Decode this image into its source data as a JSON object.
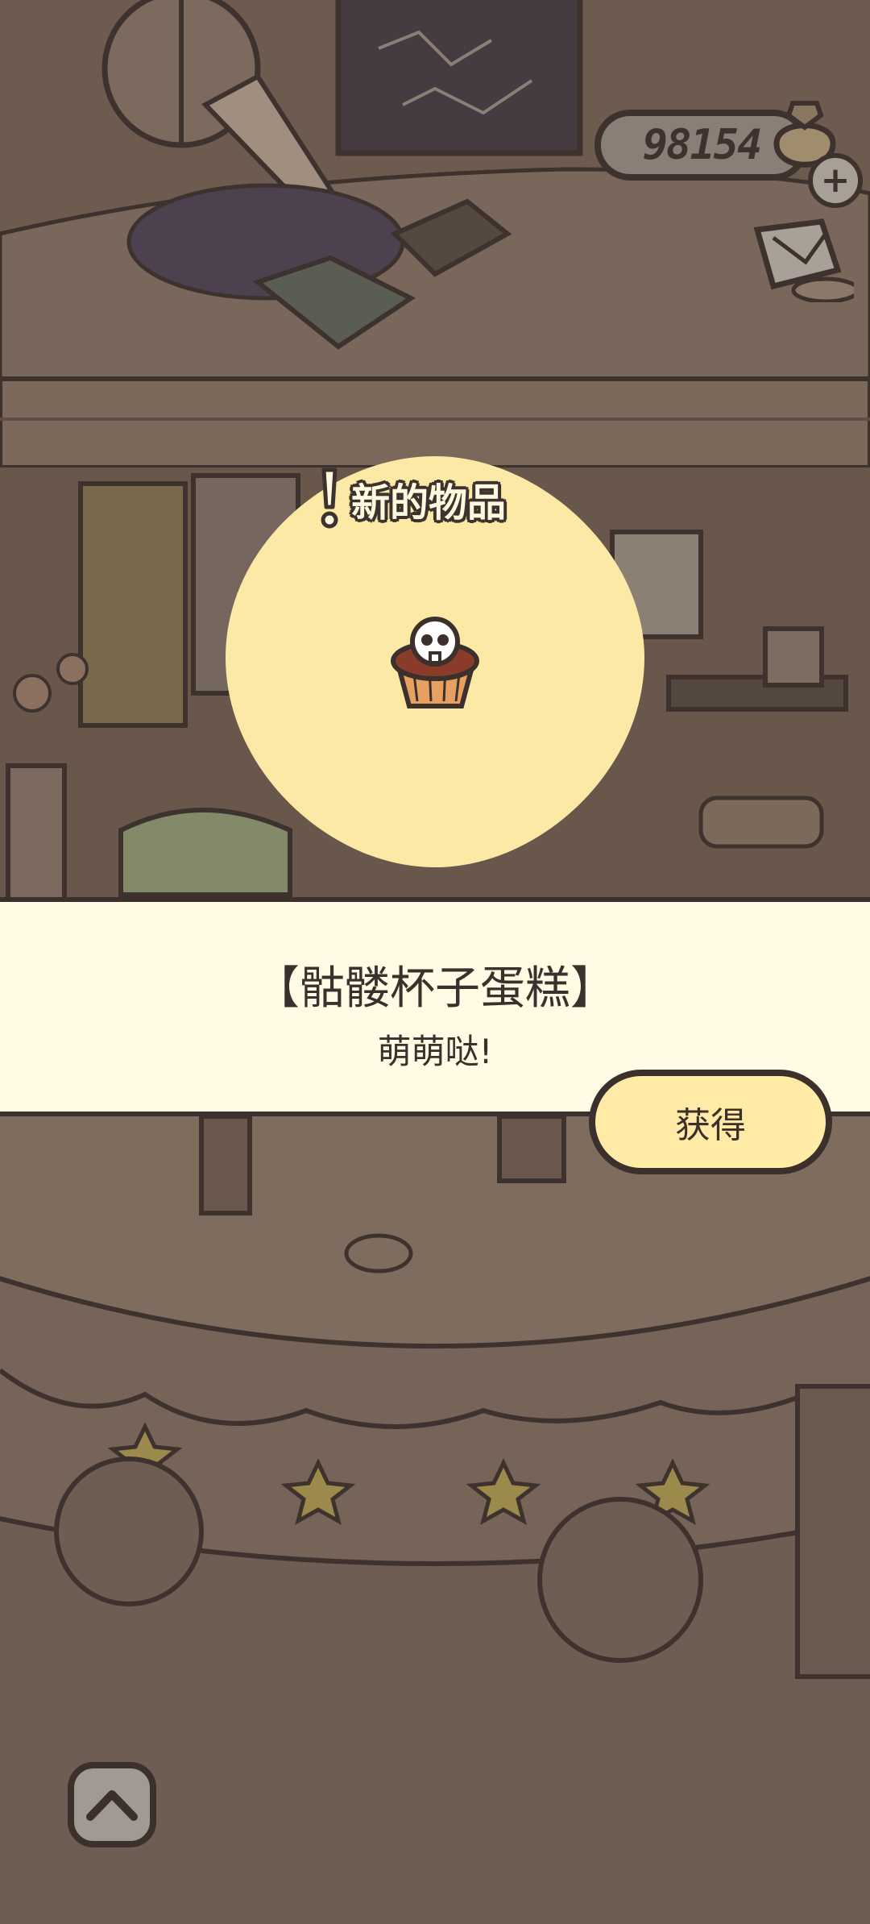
{
  "coins": {
    "amount": "98154",
    "icon": "coin-bag-icon",
    "plus_icon": "plus-icon"
  },
  "notice": {
    "title": "新的物品",
    "icon": "exclamation-icon"
  },
  "item": {
    "name": "【骷髅杯子蛋糕】",
    "description": "萌萌哒!",
    "icon": "skull-cupcake-icon"
  },
  "obtain_button": {
    "label": "获得"
  },
  "collapse_button": {
    "icon": "chevron-up-icon"
  },
  "colors": {
    "overlay_brown": "#6e5d52",
    "panel_cream": "#fffbe4",
    "button_yellow": "#ffeba6",
    "spotlight_yellow": "#fce9a6",
    "outline": "#3b302b"
  }
}
